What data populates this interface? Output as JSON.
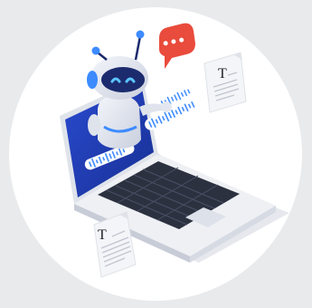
{
  "illustration": {
    "doc_letter_right": "T",
    "doc_letter_left": "T",
    "chat_bubble": "•••"
  },
  "colors": {
    "background": "#e9eaec",
    "circle": "#ffffff",
    "laptop_body": "#e7e9ee",
    "screen": "#1f3fb4",
    "robot_body": "#e4e7f0",
    "robot_visor": "#1c2b6e",
    "accent_blue": "#3d8bff",
    "bubble_red": "#e94b3c"
  }
}
